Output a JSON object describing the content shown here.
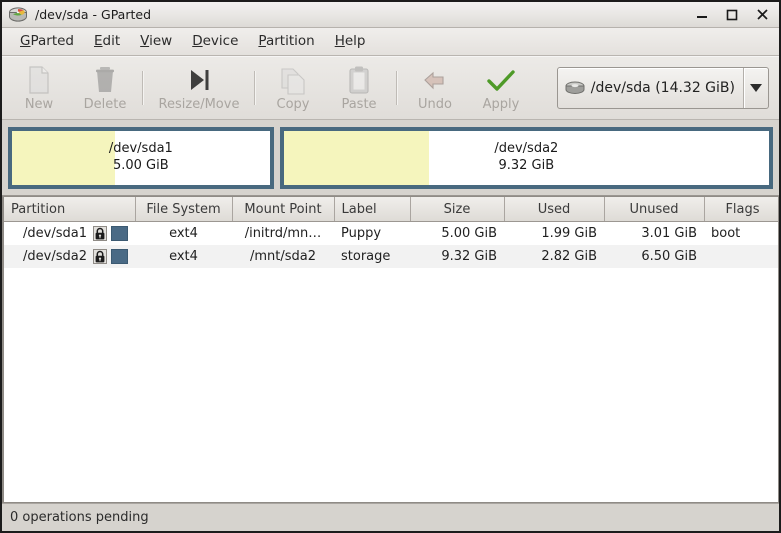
{
  "window": {
    "title": "/dev/sda - GParted",
    "icon": "disk-drive-icon",
    "controls": {
      "minimize": "minimize-icon",
      "maximize": "maximize-icon",
      "close": "close-icon"
    }
  },
  "menubar": {
    "items": [
      {
        "mnemonic": "G",
        "rest": "Parted"
      },
      {
        "mnemonic": "E",
        "rest": "dit"
      },
      {
        "mnemonic": "V",
        "rest": "iew"
      },
      {
        "mnemonic": "D",
        "rest": "evice"
      },
      {
        "mnemonic": "P",
        "rest": "artition"
      },
      {
        "mnemonic": "H",
        "rest": "elp"
      }
    ]
  },
  "toolbar": {
    "buttons": [
      {
        "label": "New",
        "icon": "new-partition-icon",
        "enabled": false
      },
      {
        "label": "Delete",
        "icon": "trash-icon",
        "enabled": false
      },
      {
        "label": "Resize/Move",
        "icon": "resize-move-icon",
        "enabled": false
      },
      {
        "label": "Copy",
        "icon": "copy-icon",
        "enabled": false
      },
      {
        "label": "Paste",
        "icon": "paste-icon",
        "enabled": false
      },
      {
        "label": "Undo",
        "icon": "undo-arrow-icon",
        "enabled": false
      },
      {
        "label": "Apply",
        "icon": "green-checkmark-icon",
        "enabled": false
      }
    ],
    "device_selector": {
      "label": "/dev/sda  (14.32 GiB)",
      "icon": "hard-disk-icon",
      "arrow": "chevron-down-icon"
    }
  },
  "graphic": {
    "partitions": [
      {
        "name": "/dev/sda1",
        "size": "5.00 GiB",
        "width_pct": 35,
        "used_pct": 40,
        "border_color": "#48697f",
        "used_color": "#f5f5bd",
        "free_color": "#ffffff"
      },
      {
        "name": "/dev/sda2",
        "size": "9.32 GiB",
        "width_pct": 65,
        "used_pct": 30,
        "border_color": "#48697f",
        "used_color": "#f5f5bd",
        "free_color": "#ffffff"
      }
    ]
  },
  "table": {
    "columns": [
      "Partition",
      "File System",
      "Mount Point",
      "Label",
      "Size",
      "Used",
      "Unused",
      "Flags"
    ],
    "rows": [
      {
        "partition": "/dev/sda1",
        "mounted_icon": "lock-icon",
        "color_swatch": "#4a6a85",
        "filesystem": "ext4",
        "mount_point": "/initrd/mn…",
        "label": "Puppy",
        "size": "5.00 GiB",
        "used": "1.99 GiB",
        "unused": "3.01 GiB",
        "flags": "boot"
      },
      {
        "partition": "/dev/sda2",
        "mounted_icon": "lock-icon",
        "color_swatch": "#4a6a85",
        "filesystem": "ext4",
        "mount_point": "/mnt/sda2",
        "label": "storage",
        "size": "9.32 GiB",
        "used": "2.82 GiB",
        "unused": "6.50 GiB",
        "flags": ""
      }
    ]
  },
  "statusbar": {
    "text": "0 operations pending"
  }
}
